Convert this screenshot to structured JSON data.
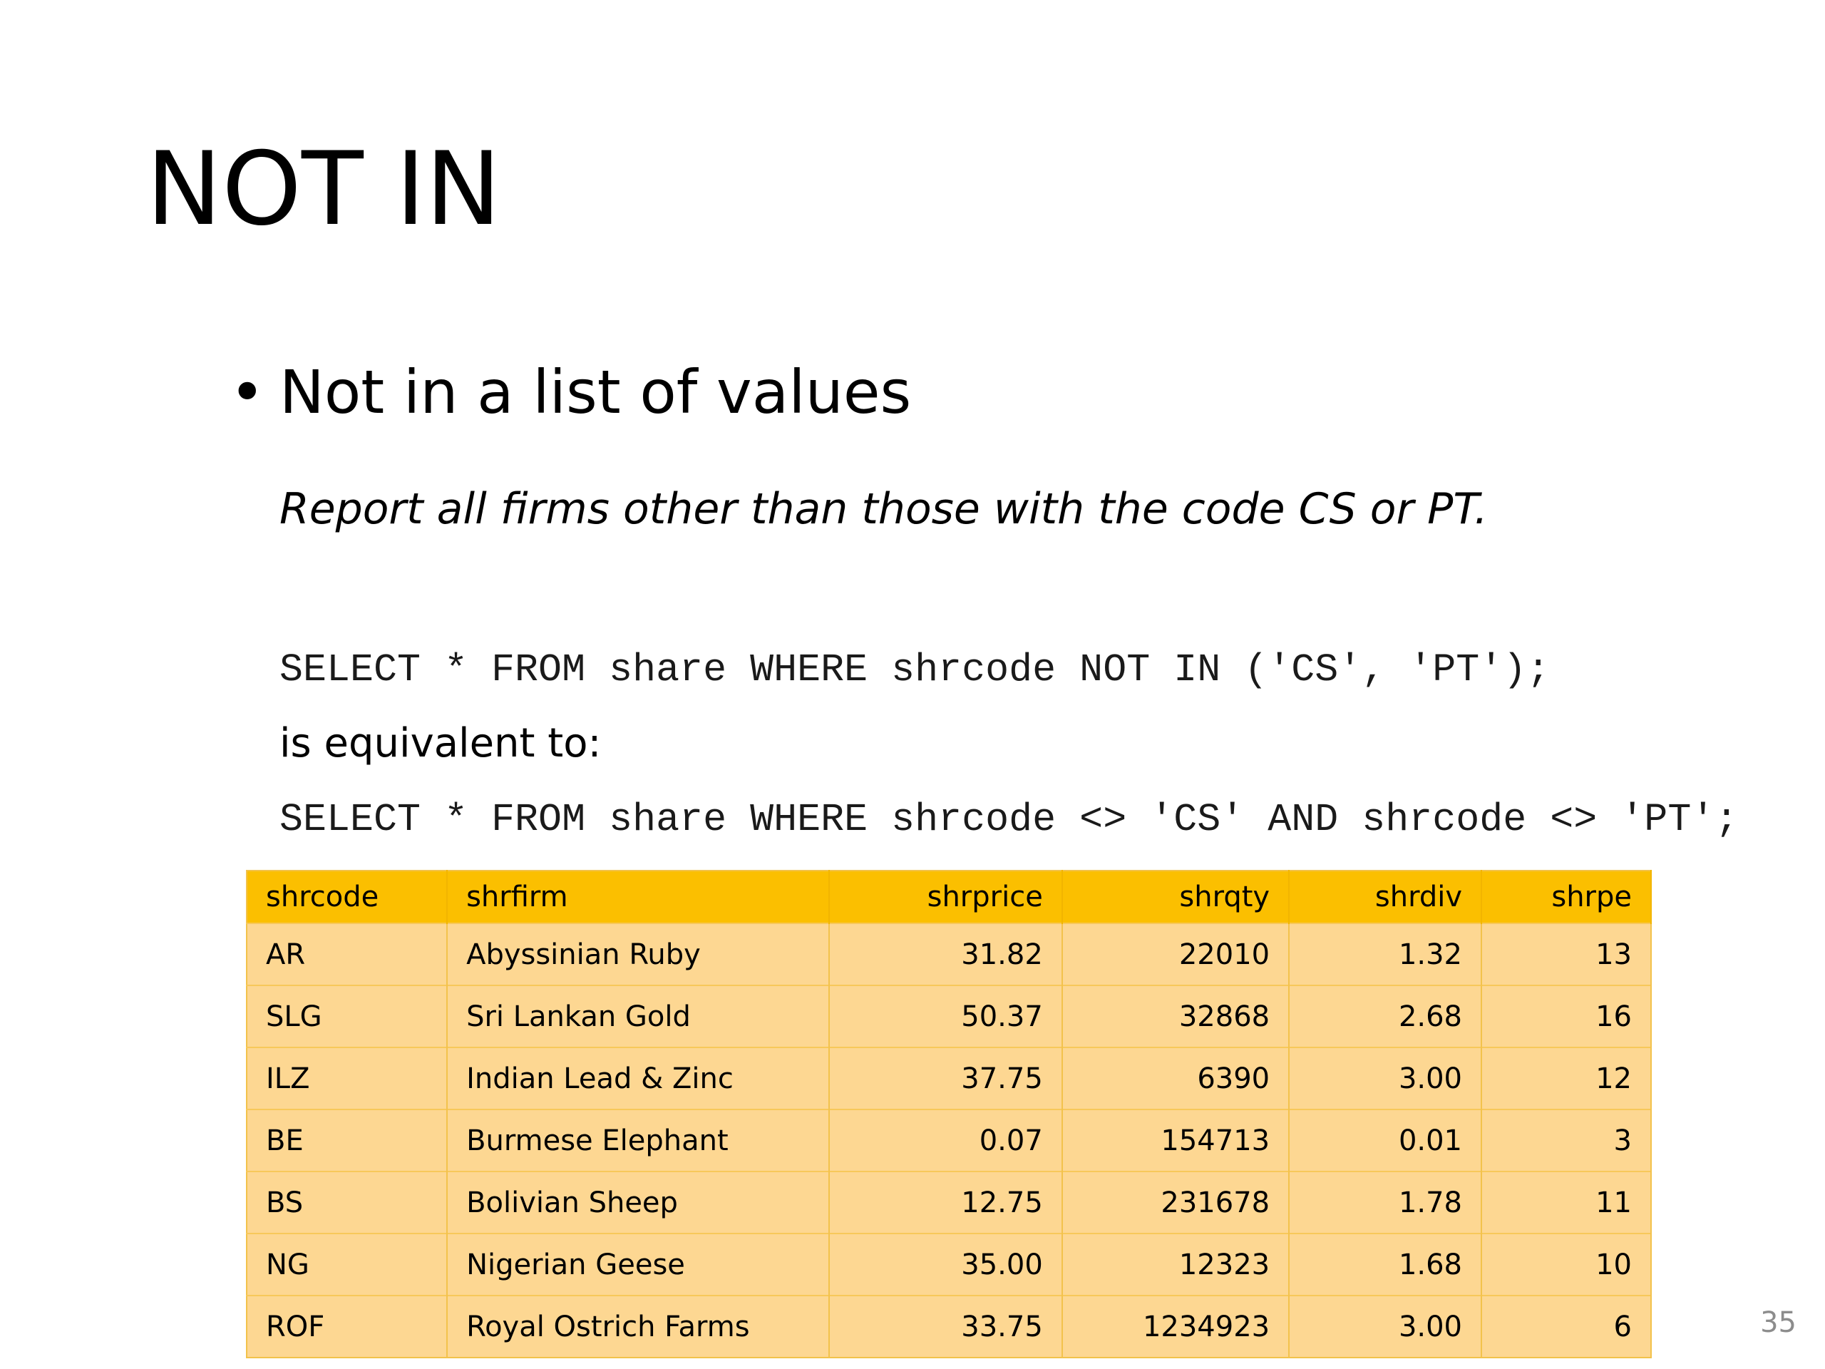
{
  "slide": {
    "title": "NOT IN",
    "bullet_symbol": "•",
    "bullet_text": "Not in a list of values",
    "subtitle": "Report all firms other than those with the code CS or PT.",
    "query_1": "SELECT * FROM share WHERE shrcode NOT IN ('CS', 'PT');",
    "equivalent_text": "is equivalent to:",
    "query_2": "SELECT * FROM share WHERE shrcode <> 'CS' AND shrcode <> 'PT';",
    "page_number": "35"
  },
  "table": {
    "columns": [
      "shrcode",
      "shrfirm",
      "shrprice",
      "shrqty",
      "shrdiv",
      "shrpe"
    ],
    "rows": [
      [
        "AR",
        "Abyssinian Ruby",
        "31.82",
        "22010",
        "1.32",
        "13"
      ],
      [
        "SLG",
        "Sri Lankan Gold",
        "50.37",
        "32868",
        "2.68",
        "16"
      ],
      [
        "ILZ",
        "Indian Lead & Zinc",
        "37.75",
        "6390",
        "3.00",
        "12"
      ],
      [
        "BE",
        "Burmese Elephant",
        "0.07",
        "154713",
        "0.01",
        "3"
      ],
      [
        "BS",
        "Bolivian Sheep",
        "12.75",
        "231678",
        "1.78",
        "11"
      ],
      [
        "NG",
        "Nigerian Geese",
        "35.00",
        "12323",
        "1.68",
        "10"
      ],
      [
        "ROF",
        "Royal Ostrich Farms",
        "33.75",
        "1234923",
        "3.00",
        "6"
      ]
    ]
  },
  "colors": {
    "header_background": "#fbbf00",
    "row_background": "#fdd792",
    "page_number": "#8c8c8c"
  }
}
